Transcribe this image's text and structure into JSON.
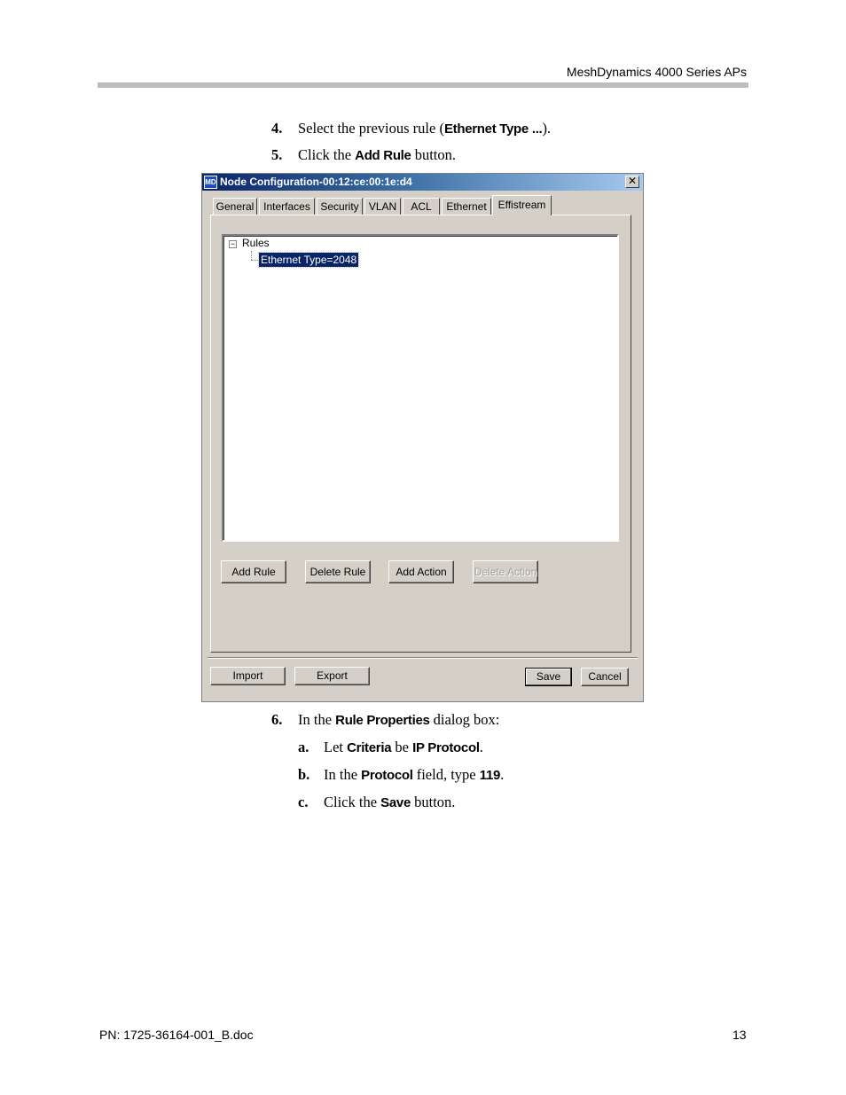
{
  "header": {
    "title": "MeshDynamics 4000 Series APs"
  },
  "steps_before": [
    {
      "num": "4.",
      "pre": "Select the previous rule (",
      "bold": "Ethernet Type ...",
      "post": ")."
    },
    {
      "num": "5.",
      "pre": "Click the ",
      "bold": "Add Rule",
      "post": " button."
    }
  ],
  "dialog": {
    "title": "Node Configuration-00:12:ce:00:1e:d4",
    "app_icon": "MD",
    "close_glyph": "✕",
    "tabs": [
      "General",
      "Interfaces",
      "Security",
      "VLAN",
      "ACL",
      "Ethernet",
      "Effistream"
    ],
    "active_tab": "Effistream",
    "tree": {
      "expander": "−",
      "root": "Rules",
      "child": "Ethernet Type=2048"
    },
    "buttons": {
      "add_rule": "Add Rule",
      "delete_rule": "Delete Rule",
      "add_action": "Add Action",
      "delete_action": "Delete Action"
    },
    "bottom_buttons": {
      "import": "Import",
      "export": "Export",
      "save": "Save",
      "cancel": "Cancel"
    }
  },
  "step6": {
    "num": "6.",
    "pre": "In the ",
    "bold": "Rule Properties",
    "post": " dialog box:"
  },
  "substeps": [
    {
      "num": "a.",
      "pre": "Let ",
      "bold1": "Criteria",
      "mid": " be ",
      "bold2": "IP Protocol",
      "post": "."
    },
    {
      "num": "b.",
      "pre": "In the ",
      "bold1": "Protocol",
      "mid": " field, type ",
      "bold2": "119",
      "post": "."
    },
    {
      "num": "c.",
      "pre": "Click the ",
      "bold1": "Save",
      "mid": " button.",
      "bold2": "",
      "post": ""
    }
  ],
  "footer": {
    "doc": "PN: 1725-36164-001_B.doc",
    "page": "13"
  }
}
